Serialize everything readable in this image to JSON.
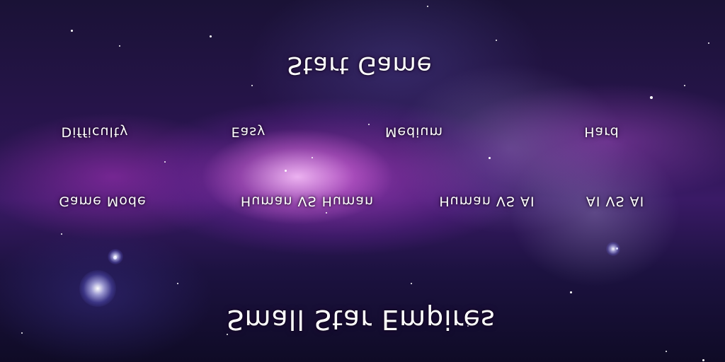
{
  "menu": {
    "start_label": "Start Game",
    "difficulty": {
      "label": "Difficulty",
      "options": [
        "Easy",
        "Medium",
        "Hard"
      ]
    },
    "game_mode": {
      "label": "Game Mode",
      "options": [
        "Human VS Human",
        "Human VS AI",
        "AI VS AI"
      ]
    },
    "title": "Small Star Empires"
  },
  "colors": {
    "text": "#ffffff",
    "background_deep": "#1a1236",
    "nebula_purple": "#b046d2",
    "nebula_pink": "#ffc8ff"
  }
}
